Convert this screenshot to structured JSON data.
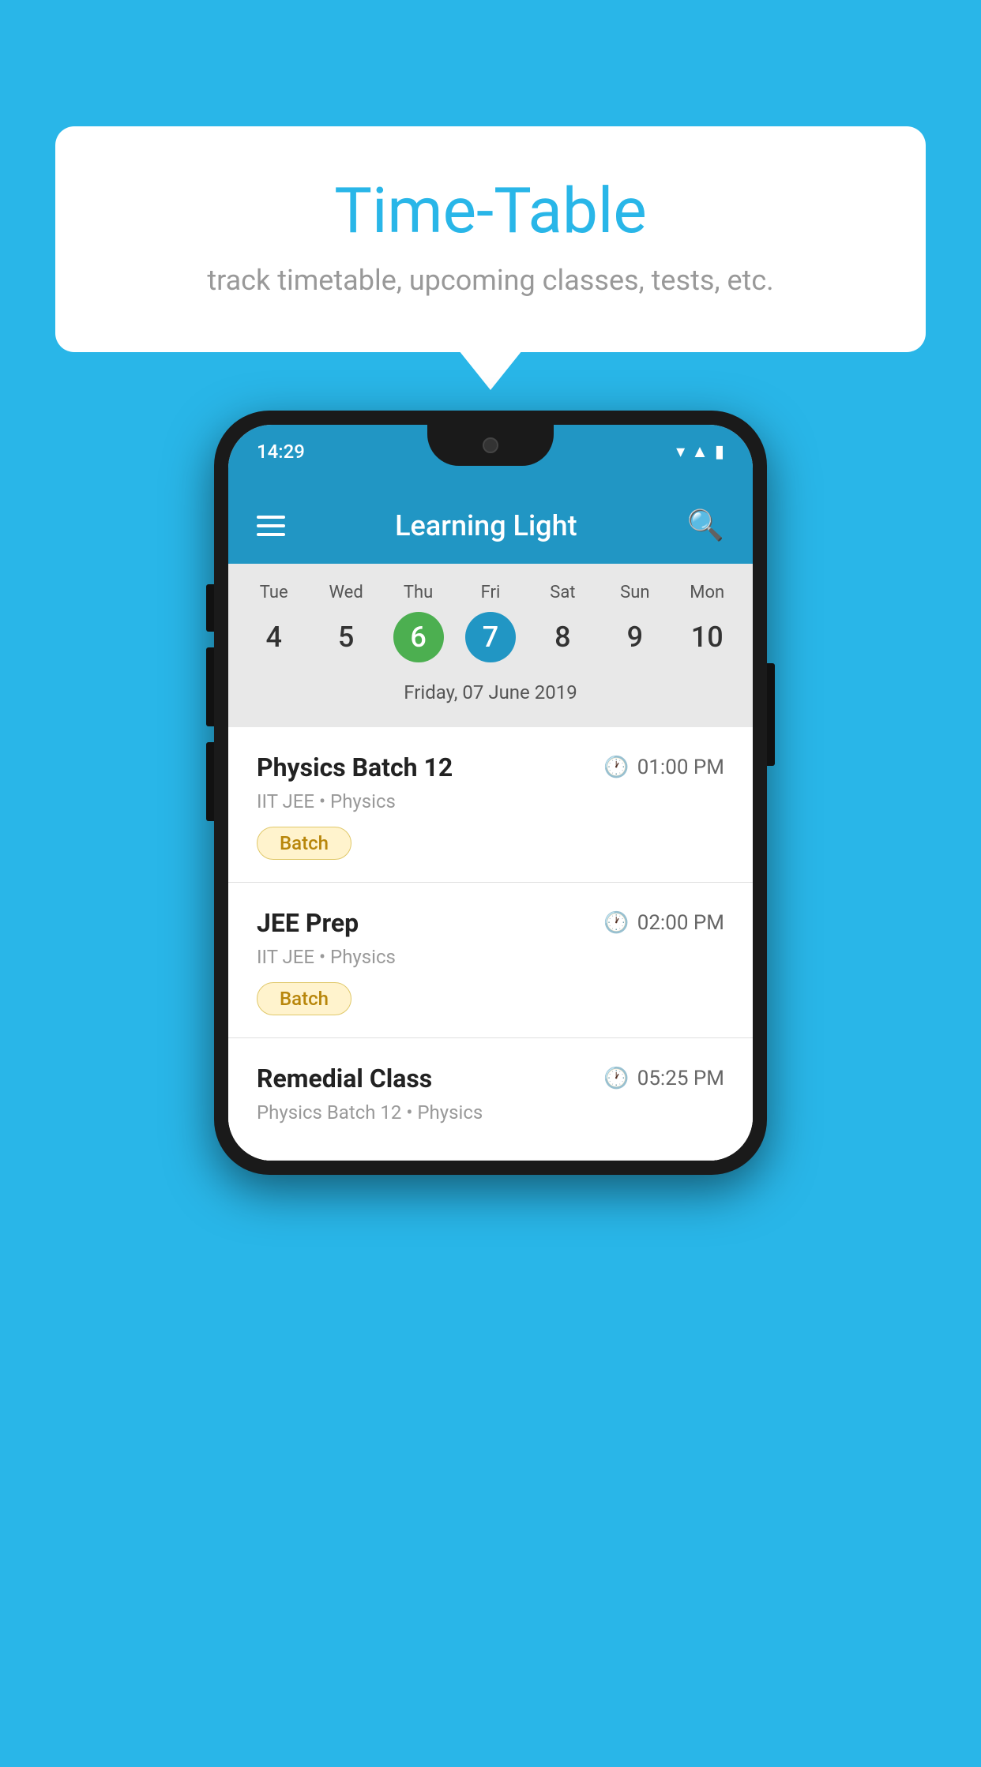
{
  "background_color": "#29b6e8",
  "speech_bubble": {
    "title": "Time-Table",
    "subtitle": "track timetable, upcoming classes, tests, etc."
  },
  "phone": {
    "status_bar": {
      "time": "14:29",
      "icons": [
        "wifi",
        "signal",
        "battery"
      ]
    },
    "app_bar": {
      "title": "Learning Light",
      "menu_icon": "hamburger-menu",
      "search_icon": "search"
    },
    "calendar": {
      "days": [
        {
          "label": "Tue",
          "num": "4"
        },
        {
          "label": "Wed",
          "num": "5"
        },
        {
          "label": "Thu",
          "num": "6",
          "state": "today"
        },
        {
          "label": "Fri",
          "num": "7",
          "state": "selected"
        },
        {
          "label": "Sat",
          "num": "8"
        },
        {
          "label": "Sun",
          "num": "9"
        },
        {
          "label": "Mon",
          "num": "10"
        }
      ],
      "selected_date_label": "Friday, 07 June 2019"
    },
    "schedule": {
      "items": [
        {
          "title": "Physics Batch 12",
          "time": "01:00 PM",
          "meta": "IIT JEE • Physics",
          "badge": "Batch"
        },
        {
          "title": "JEE Prep",
          "time": "02:00 PM",
          "meta": "IIT JEE • Physics",
          "badge": "Batch"
        },
        {
          "title": "Remedial Class",
          "time": "05:25 PM",
          "meta": "Physics Batch 12 • Physics",
          "badge": null
        }
      ]
    }
  }
}
